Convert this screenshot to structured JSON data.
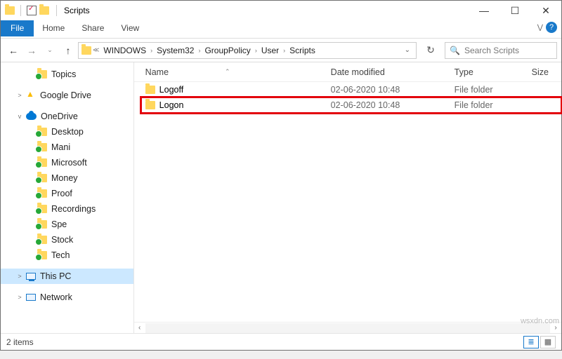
{
  "window": {
    "title": "Scripts"
  },
  "ribbon": {
    "file": "File",
    "tabs": [
      "Home",
      "Share",
      "View"
    ]
  },
  "breadcrumb": [
    "WINDOWS",
    "System32",
    "GroupPolicy",
    "User",
    "Scripts"
  ],
  "search": {
    "placeholder": "Search Scripts"
  },
  "tree": {
    "items": [
      {
        "label": "Topics",
        "icon": "folder",
        "sync": true,
        "indent": 1,
        "exp": ""
      },
      {
        "label": "Google Drive",
        "icon": "gd",
        "sync": false,
        "indent": 0,
        "exp": ">"
      },
      {
        "label": "OneDrive",
        "icon": "cloud",
        "sync": false,
        "indent": 0,
        "exp": "v"
      },
      {
        "label": "Desktop",
        "icon": "folder",
        "sync": true,
        "indent": 1,
        "exp": ""
      },
      {
        "label": "Mani",
        "icon": "folder",
        "sync": true,
        "indent": 1,
        "exp": ""
      },
      {
        "label": "Microsoft",
        "icon": "folder",
        "sync": true,
        "indent": 1,
        "exp": ""
      },
      {
        "label": "Money",
        "icon": "folder",
        "sync": true,
        "indent": 1,
        "exp": ""
      },
      {
        "label": "Proof",
        "icon": "folder",
        "sync": true,
        "indent": 1,
        "exp": ""
      },
      {
        "label": "Recordings",
        "icon": "folder",
        "sync": true,
        "indent": 1,
        "exp": ""
      },
      {
        "label": "Spe",
        "icon": "folder",
        "sync": true,
        "indent": 1,
        "exp": ""
      },
      {
        "label": "Stock",
        "icon": "folder",
        "sync": true,
        "indent": 1,
        "exp": ""
      },
      {
        "label": "Tech",
        "icon": "folder",
        "sync": true,
        "indent": 1,
        "exp": ""
      },
      {
        "label": "This PC",
        "icon": "pc",
        "sync": false,
        "indent": 0,
        "exp": ">",
        "selected": true
      },
      {
        "label": "Network",
        "icon": "net",
        "sync": false,
        "indent": 0,
        "exp": ">"
      }
    ]
  },
  "columns": {
    "name": "Name",
    "date": "Date modified",
    "type": "Type",
    "size": "Size"
  },
  "rows": [
    {
      "name": "Logoff",
      "date": "02-06-2020 10:48",
      "type": "File folder",
      "highlight": false
    },
    {
      "name": "Logon",
      "date": "02-06-2020 10:48",
      "type": "File folder",
      "highlight": true
    }
  ],
  "status": {
    "count": "2 items"
  },
  "watermark": "wsxdn.com"
}
